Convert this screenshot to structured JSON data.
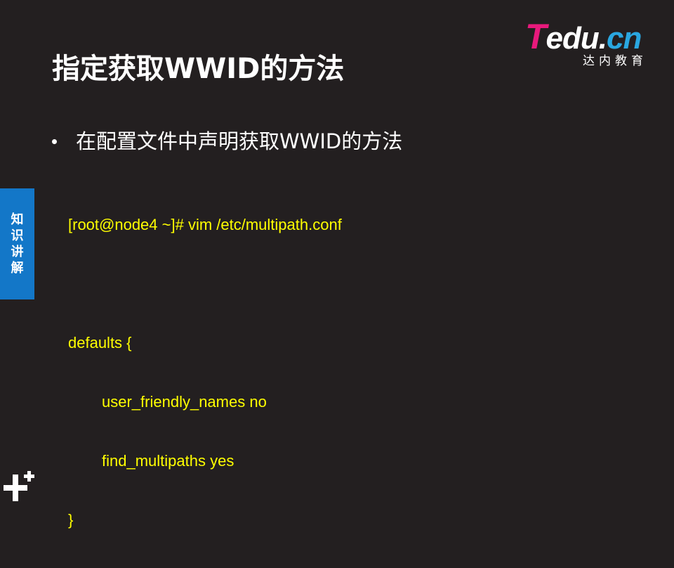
{
  "logo": {
    "t": "T",
    "rest": "edu.",
    "cn": "cn",
    "sub": "达内教育"
  },
  "title": "指定获取WWID的方法",
  "bullet": "在配置文件中声明获取WWID的方法",
  "code": [
    "[root@node4 ~]# vim /etc/multipath.conf",
    "",
    "defaults {",
    "user_friendly_names no",
    "find_multipaths yes",
    "}"
  ],
  "side_tab": [
    "知",
    "识",
    "讲",
    "解"
  ],
  "colors": {
    "background": "#231f20",
    "code": "#ffff00",
    "side_tab": "#1377c8",
    "logo_t": "#e8197c",
    "logo_cn": "#2aa7e0"
  },
  "icons": [
    "plus-large-icon",
    "plus-small-icon"
  ]
}
